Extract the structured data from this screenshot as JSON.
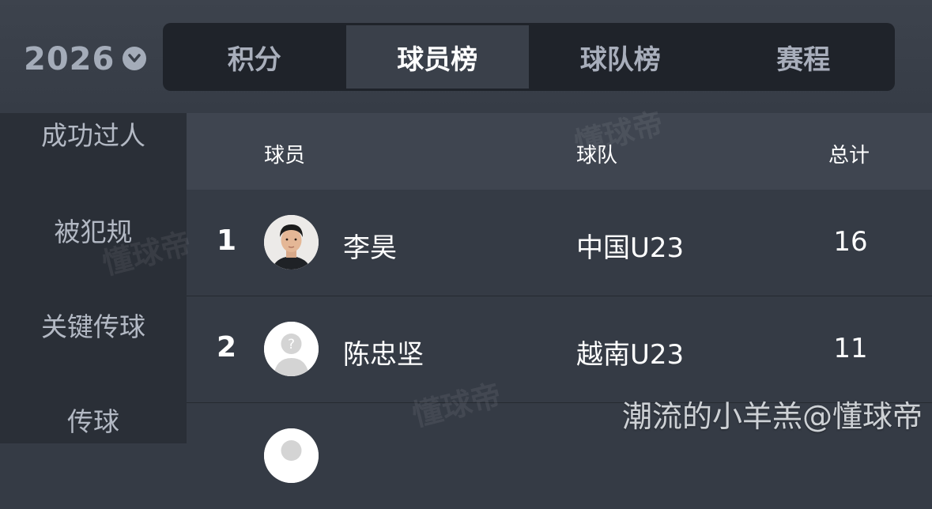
{
  "year_selector": {
    "label": "2026",
    "icon": "chevron-down-icon"
  },
  "tabs": [
    {
      "label": "积分",
      "active": false
    },
    {
      "label": "球员榜",
      "active": true
    },
    {
      "label": "球队榜",
      "active": false
    },
    {
      "label": "赛程",
      "active": false
    }
  ],
  "sidebar": {
    "items": [
      {
        "label": "成功过人"
      },
      {
        "label": "被犯规"
      },
      {
        "label": "关键传球"
      },
      {
        "label": "传球"
      }
    ]
  },
  "table": {
    "headers": {
      "player": "球员",
      "team": "球队",
      "total": "总计"
    },
    "rows": [
      {
        "rank": "1",
        "name": "李昊",
        "team": "中国U23",
        "total": "16",
        "avatar": "player-photo"
      },
      {
        "rank": "2",
        "name": "陈忠坚",
        "team": "越南U23",
        "total": "11",
        "avatar": "placeholder-avatar"
      }
    ]
  },
  "watermark": "懂球帝",
  "credit": "潮流的小羊羔@懂球帝",
  "colors": {
    "background": "#353b45",
    "tab_bar": "#1f232a",
    "sidebar": "#2a2f37",
    "header_row": "#3f4550"
  }
}
